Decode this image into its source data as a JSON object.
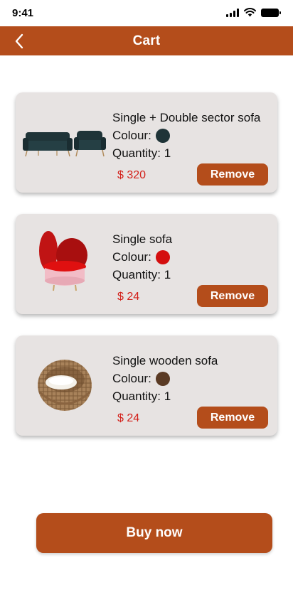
{
  "status_bar": {
    "time": "9:41"
  },
  "header": {
    "title": "Cart",
    "back_icon": "chevron-left-icon"
  },
  "colors": {
    "accent": "#b44d1b",
    "card_bg": "#e7e3e2",
    "price": "#d3211b"
  },
  "cart": {
    "colour_label": "Colour:",
    "items": [
      {
        "name": "Single + Double sector sofa",
        "colour_hex": "#1f3438",
        "quantity": "Quantity: 1",
        "price": "$ 320",
        "remove_label": "Remove",
        "image": "navy-sofa-set-image"
      },
      {
        "name": "Single sofa",
        "colour_hex": "#d40e0e",
        "quantity": "Quantity: 1",
        "price": "$ 24",
        "remove_label": "Remove",
        "image": "red-pink-armchair-image"
      },
      {
        "name": "Single wooden sofa",
        "colour_hex": "#5a3a24",
        "quantity": "Quantity: 1",
        "price": "$ 24",
        "remove_label": "Remove",
        "image": "wicker-egg-chair-image"
      }
    ]
  },
  "footer": {
    "buy_label": "Buy now"
  }
}
